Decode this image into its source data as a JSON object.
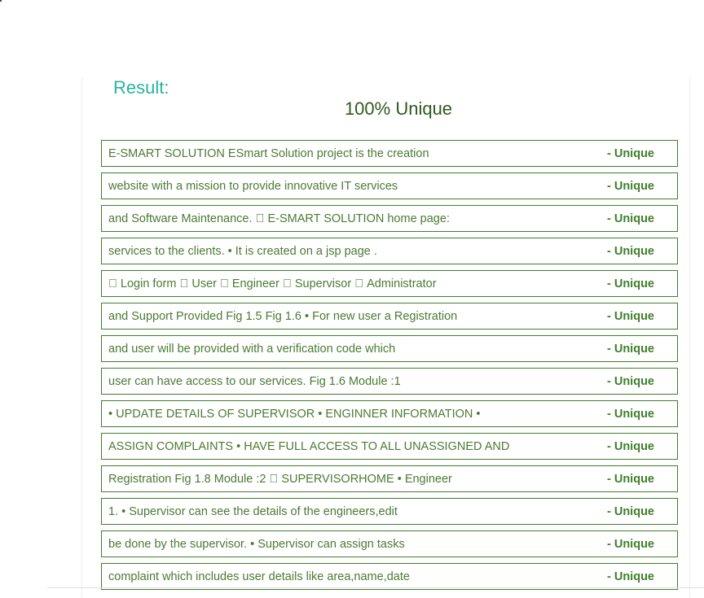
{
  "result": {
    "label": "Result:",
    "score": "100% Unique"
  },
  "rows": [
    {
      "text": "E-SMART SOLUTION ESmart Solution project is the creation",
      "status": "- Unique"
    },
    {
      "text": "website with a mission to provide innovative IT services",
      "status": "- Unique"
    },
    {
      "text": "and Software Maintenance.  E-SMART SOLUTION home page:",
      "status": "- Unique"
    },
    {
      "text": "services to the clients. • It is created on a jsp page .",
      "status": "- Unique"
    },
    {
      "text": " Login form  User  Engineer  Supervisor  Administrator",
      "status": "- Unique"
    },
    {
      "text": "and Support Provided Fig 1.5 Fig 1.6 • For new user a Registration",
      "status": "- Unique"
    },
    {
      "text": "and user will be provided with a verification code which",
      "status": "- Unique"
    },
    {
      "text": "user can have access to our services. Fig 1.6 Module :1",
      "status": "- Unique"
    },
    {
      "text": "• UPDATE DETAILS OF SUPERVISOR • ENGINNER INFORMATION •",
      "status": "- Unique"
    },
    {
      "text": "ASSIGN COMPLAINTS • HAVE FULL ACCESS TO ALL UNASSIGNED AND",
      "status": "- Unique"
    },
    {
      "text": "Registration Fig 1.8 Module :2  SUPERVISORHOME • Engineer",
      "status": "- Unique"
    },
    {
      "text": "1. • Supervisor can see the details of the engineers,edit",
      "status": "- Unique"
    },
    {
      "text": "be done by the supervisor. • Supervisor can assign tasks",
      "status": "- Unique"
    },
    {
      "text": "complaint which includes user details like area,name,date",
      "status": "- Unique"
    }
  ],
  "colors": {
    "label": "#2bb3a0",
    "score": "#2d5a1e",
    "row_border": "#3f7f2a",
    "row_text": "#4b7a33"
  }
}
